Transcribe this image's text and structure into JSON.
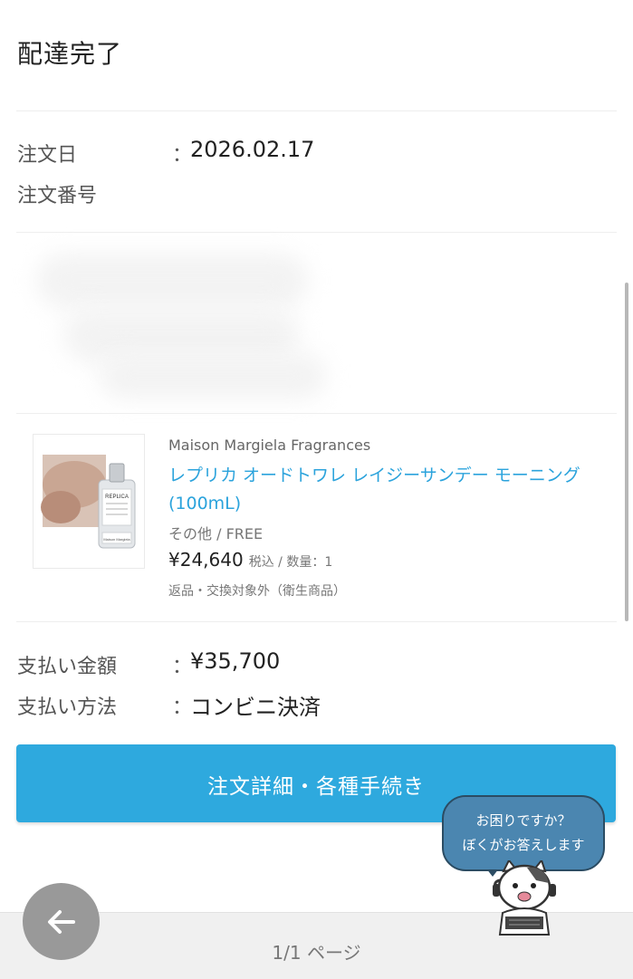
{
  "order": {
    "status": "配達完了",
    "date_label": "注文日",
    "date_value": "2026.02.17",
    "number_label": "注文番号",
    "colon": "："
  },
  "product": {
    "brand": "Maison Margiela Fragrances",
    "name": "レプリカ オードトワレ レイジーサンデー モーニング (100mL)",
    "variant": "その他 / FREE",
    "price": "¥24,640",
    "price_meta": "税込 / 数量：1",
    "note": "返品・交換対象外（衛生商品）",
    "bottle_label": "REPLICA",
    "bottle_brand": "Maison Margiela"
  },
  "payment": {
    "amount_label": "支払い金額",
    "amount_value": "¥35,700",
    "method_label": "支払い方法",
    "method_value": "コンビニ決済"
  },
  "detail_button": {
    "label": "注文詳細・各種手続き"
  },
  "chat": {
    "line1": "お困りですか？",
    "line2": "ぼくがお答えします"
  },
  "footer": {
    "page_indicator": "1/1 ページ"
  },
  "colors": {
    "accent": "#2ea9de",
    "link": "#2ba3dc",
    "chat_bubble": "#4b86b0"
  }
}
